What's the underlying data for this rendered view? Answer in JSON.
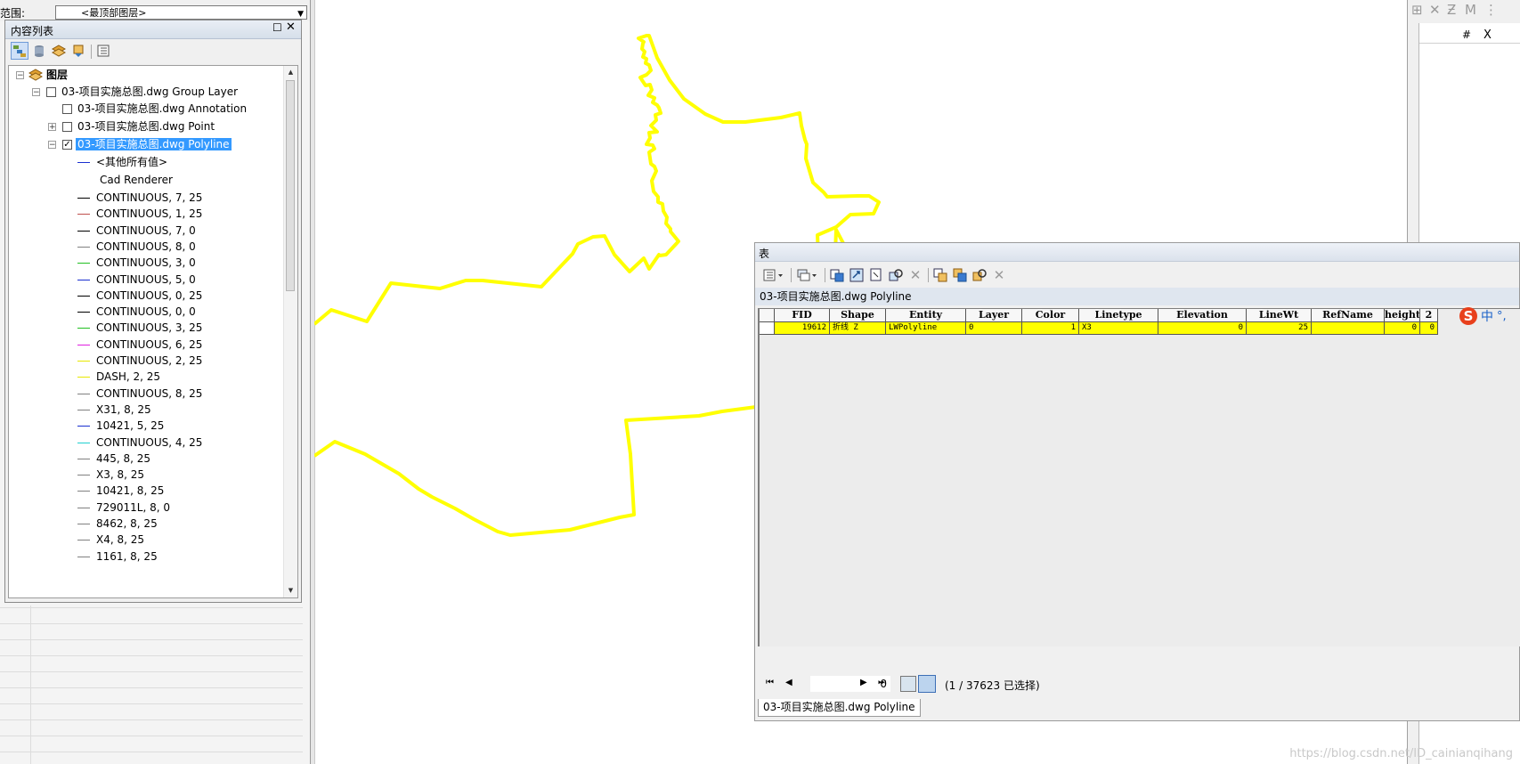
{
  "scope": {
    "label": "范围:",
    "value": "<最顶部图层>"
  },
  "toc": {
    "title": "内容列表",
    "dock_glyph": "☐",
    "close_glyph": "✕",
    "root": "图层",
    "group_layer": "03-项目实施总图.dwg Group Layer",
    "layers": [
      {
        "name": "03-项目实施总图.dwg Annotation",
        "checked": false
      },
      {
        "name": "03-项目实施总图.dwg Point",
        "checked": false
      },
      {
        "name": "03-项目实施总图.dwg Polyline",
        "checked": true,
        "selected": true
      }
    ],
    "legend_other": "<其他所有值>",
    "renderer_label": "Cad Renderer",
    "legend_items": [
      {
        "label": "CONTINUOUS, 7, 25",
        "color": "#000000"
      },
      {
        "label": "CONTINUOUS, 1, 25",
        "color": "#c0504d"
      },
      {
        "label": "CONTINUOUS, 7, 0",
        "color": "#000000"
      },
      {
        "label": "CONTINUOUS, 8, 0",
        "color": "#808080"
      },
      {
        "label": "CONTINUOUS, 3, 0",
        "color": "#22c022"
      },
      {
        "label": "CONTINUOUS, 5, 0",
        "color": "#1a2fd0"
      },
      {
        "label": "CONTINUOUS, 0, 25",
        "color": "#000000"
      },
      {
        "label": "CONTINUOUS, 0, 0",
        "color": "#000000"
      },
      {
        "label": "CONTINUOUS, 3, 25",
        "color": "#22c022"
      },
      {
        "label": "CONTINUOUS, 6, 25",
        "color": "#e020e0"
      },
      {
        "label": "CONTINUOUS, 2, 25",
        "color": "#e8e800"
      },
      {
        "label": "DASH, 2, 25",
        "color": "#e8e800"
      },
      {
        "label": "CONTINUOUS, 8, 25",
        "color": "#808080"
      },
      {
        "label": "X31, 8, 25",
        "color": "#808080"
      },
      {
        "label": "10421, 5, 25",
        "color": "#1a2fd0"
      },
      {
        "label": "CONTINUOUS, 4, 25",
        "color": "#20d0d0"
      },
      {
        "label": "445, 8, 25",
        "color": "#808080"
      },
      {
        "label": "X3, 8, 25",
        "color": "#808080"
      },
      {
        "label": "10421, 8, 25",
        "color": "#808080"
      },
      {
        "label": "729011L, 8, 0",
        "color": "#808080"
      },
      {
        "label": "8462, 8, 25",
        "color": "#808080"
      },
      {
        "label": "X4, 8, 25",
        "color": "#808080"
      },
      {
        "label": "1161, 8, 25",
        "color": "#808080"
      }
    ]
  },
  "table": {
    "window_title": "表",
    "layer_title": "03-项目实施总图.dwg Polyline",
    "columns": [
      "FID",
      "Shape",
      "Entity",
      "Layer",
      "Color",
      "Linetype",
      "Elevation",
      "LineWt",
      "RefName",
      "height",
      "2"
    ],
    "row": [
      "19612",
      "折线 Z",
      "LWPolyline",
      "0",
      "1",
      "X3",
      "0",
      "25",
      "",
      "0",
      "0"
    ],
    "ime": {
      "s": "S",
      "zh": "中",
      "punct": "°,"
    },
    "nav": {
      "first": "⏮",
      "prev": "◀",
      "record": "0",
      "next": "▶",
      "last": "⏭"
    },
    "selection_count": "(1 / 37623 已选择)",
    "tab_label": "03-项目实施总图.dwg Polyline"
  },
  "right_panel": {
    "hash": "#",
    "x": "X"
  },
  "watermark": "https://blog.csdn.net/ID_cainianqihang",
  "colors": {
    "polyline": "#ffff00",
    "selection_blue": "#3399ff"
  }
}
